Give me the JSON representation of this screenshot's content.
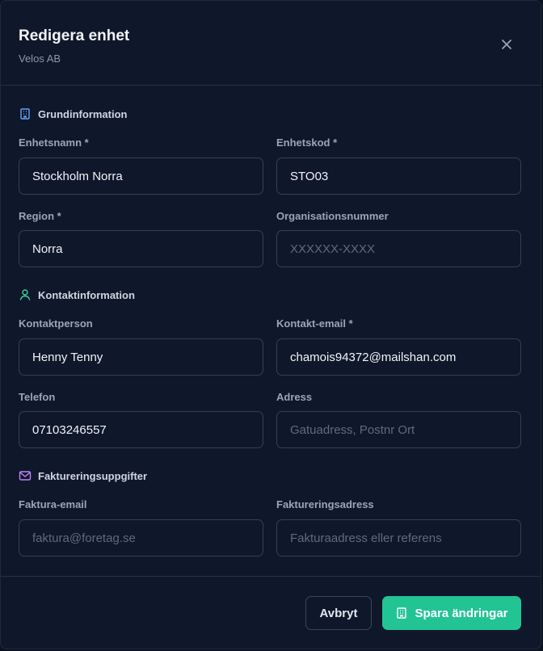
{
  "header": {
    "title": "Redigera enhet",
    "subtitle": "Velos AB",
    "close_icon": "close-icon"
  },
  "sections": {
    "basic": {
      "title": "Grundinformation",
      "icon": "building-icon",
      "color": "#60a5fa"
    },
    "contact": {
      "title": "Kontaktinformation",
      "icon": "user-icon",
      "color": "#34d399"
    },
    "billing": {
      "title": "Faktureringsuppgifter",
      "icon": "mail-icon",
      "color": "#c084fc"
    }
  },
  "fields": {
    "unit_name": {
      "label": "Enhetsnamn *",
      "value": "Stockholm Norra",
      "placeholder": ""
    },
    "unit_code": {
      "label": "Enhetskod *",
      "value": "STO03",
      "placeholder": ""
    },
    "region": {
      "label": "Region *",
      "value": "Norra",
      "placeholder": ""
    },
    "org_number": {
      "label": "Organisationsnummer",
      "value": "",
      "placeholder": "XXXXXX-XXXX"
    },
    "contact_person": {
      "label": "Kontaktperson",
      "value": "Henny Tenny",
      "placeholder": ""
    },
    "contact_email": {
      "label": "Kontakt-email *",
      "value": "chamois94372@mailshan.com",
      "placeholder": ""
    },
    "phone": {
      "label": "Telefon",
      "value": "07103246557",
      "placeholder": ""
    },
    "address": {
      "label": "Adress",
      "value": "",
      "placeholder": "Gatuadress, Postnr Ort"
    },
    "invoice_email": {
      "label": "Faktura-email",
      "value": "",
      "placeholder": "faktura@foretag.se"
    },
    "invoice_address": {
      "label": "Faktureringsadress",
      "value": "",
      "placeholder": "Fakturaadress eller referens"
    }
  },
  "footer": {
    "cancel_label": "Avbryt",
    "save_label": "Spara ändringar",
    "save_icon": "building-icon",
    "accent_color": "#22c493"
  }
}
